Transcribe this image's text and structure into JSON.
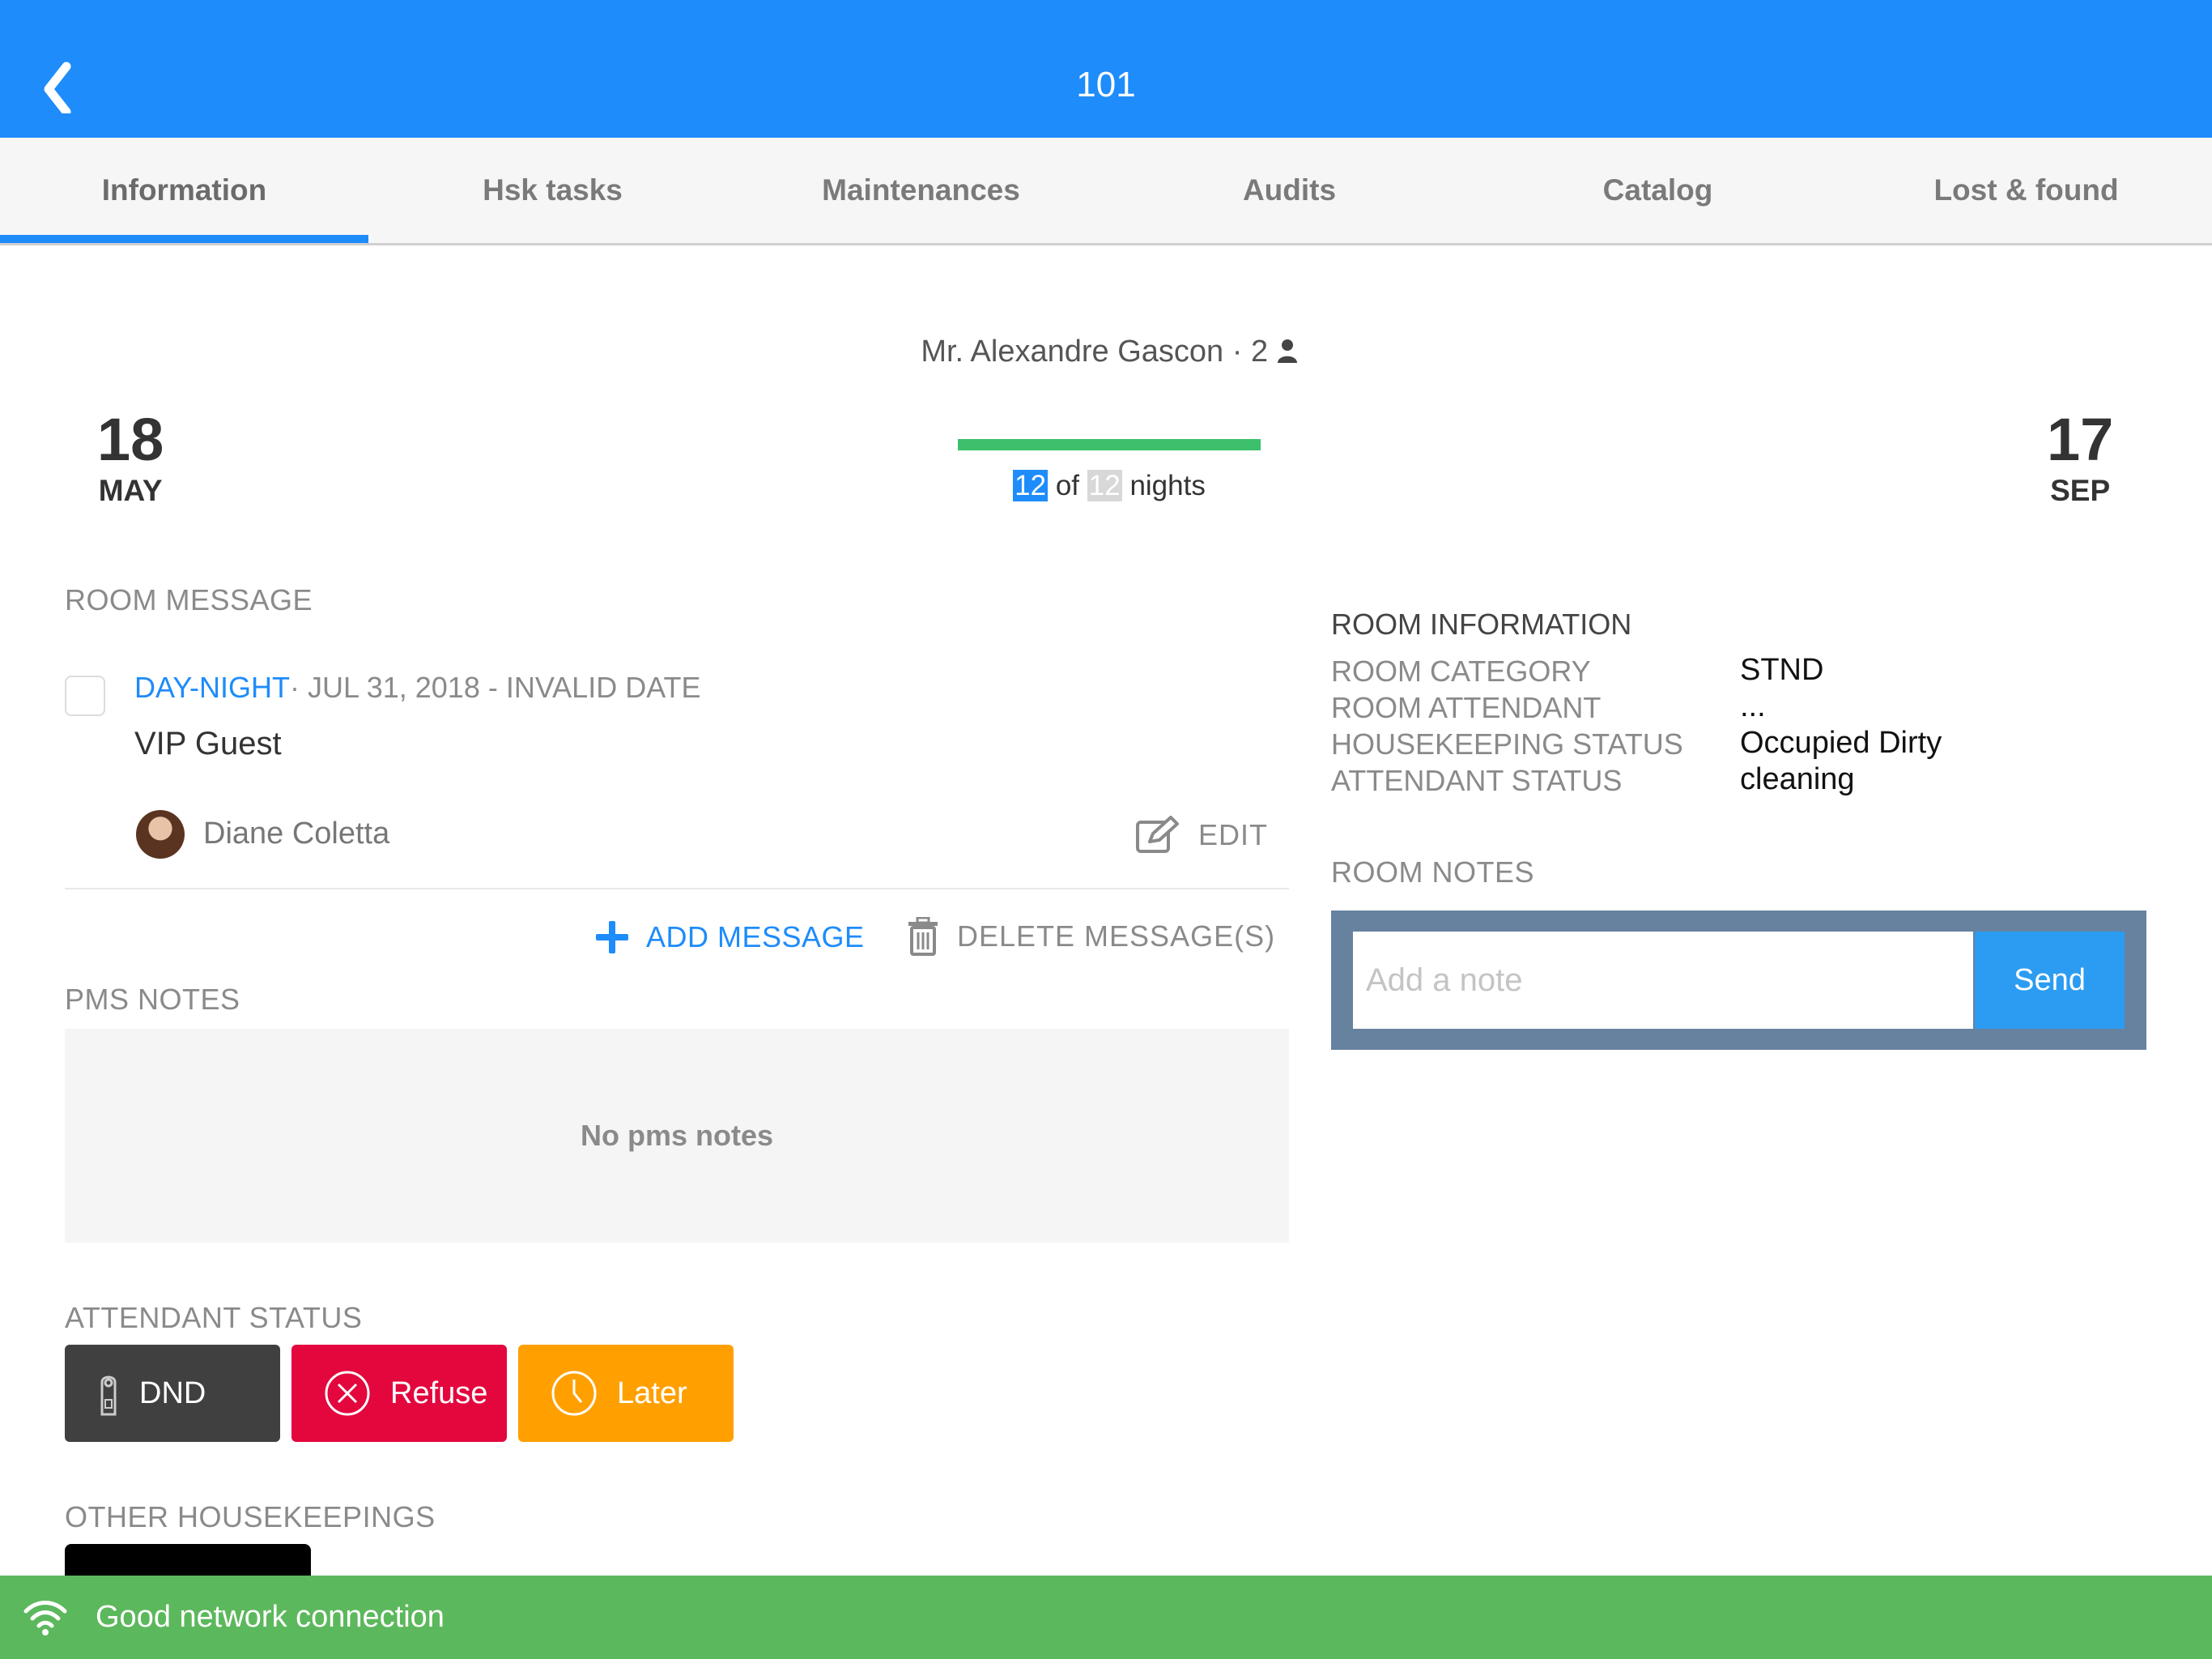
{
  "header": {
    "title": "101",
    "back_icon": "chevron-left-icon"
  },
  "tabs": [
    {
      "label": "Information",
      "active": true
    },
    {
      "label": "Hsk tasks"
    },
    {
      "label": "Maintenances"
    },
    {
      "label": "Audits"
    },
    {
      "label": "Catalog"
    },
    {
      "label": "Lost & found"
    }
  ],
  "stay": {
    "guest": "Mr. Alexandre Gascon · 2",
    "arrival": {
      "day": "18",
      "month": "MAY"
    },
    "departure": {
      "day": "17",
      "month": "SEP"
    },
    "nights_current": "12",
    "nights_of": "of",
    "nights_total": "12",
    "nights_label": "nights",
    "progress": 1.0
  },
  "room_message": {
    "section_label": "ROOM MESSAGE",
    "type": "DAY-NIGHT",
    "date": "· JUL 31, 2018 - INVALID DATE",
    "body": "VIP Guest",
    "author": "Diane Coletta",
    "edit_label": "EDIT",
    "add_label": "ADD MESSAGE",
    "delete_label": "DELETE MESSAGE(S)"
  },
  "pms_notes": {
    "section_label": "PMS NOTES",
    "empty_text": "No pms notes"
  },
  "attendant_status": {
    "section_label": "ATTENDANT STATUS",
    "buttons": [
      {
        "label": "DND",
        "color": "#404040",
        "icon": "door-hanger-icon"
      },
      {
        "label": "Refuse",
        "color": "#e3073e",
        "icon": "circle-x-icon"
      },
      {
        "label": "Later",
        "color": "#ffa000",
        "icon": "clock-icon"
      }
    ]
  },
  "other_housekeepings": {
    "section_label": "OTHER HOUSEKEEPINGS"
  },
  "room_information": {
    "title": "ROOM INFORMATION",
    "rows": [
      {
        "key": "ROOM CATEGORY",
        "value": "STND"
      },
      {
        "key": "ROOM ATTENDANT",
        "value": "..."
      },
      {
        "key": "HOUSEKEEPING STATUS",
        "value": "Occupied Dirty"
      },
      {
        "key": "ATTENDANT STATUS",
        "value": "cleaning"
      }
    ]
  },
  "room_notes": {
    "section_label": "ROOM NOTES",
    "placeholder": "Add a note",
    "send_label": "Send"
  },
  "footer": {
    "status_text": "Good network connection",
    "icon": "wifi-icon"
  },
  "colors": {
    "primary": "#1e8cfa",
    "success": "#5cb85c",
    "progress": "#3dc06b",
    "danger": "#e3073e",
    "warning": "#ffa000"
  }
}
